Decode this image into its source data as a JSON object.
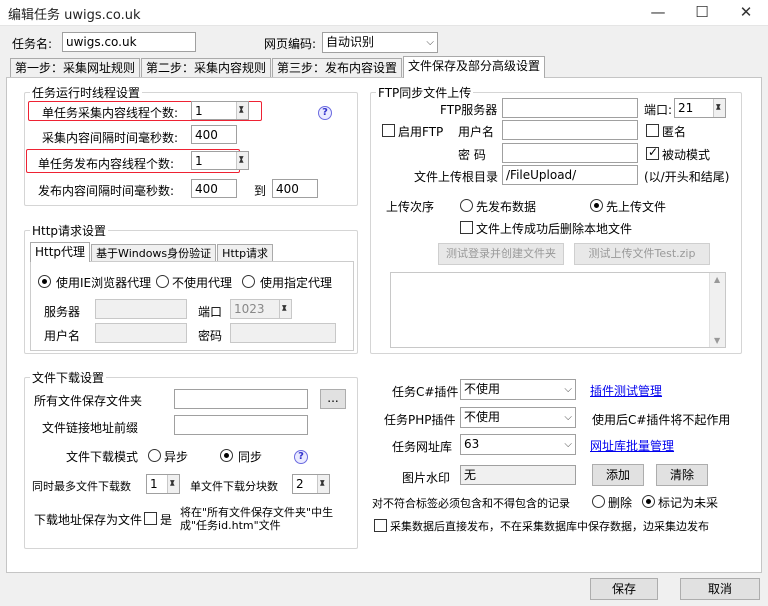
{
  "window": {
    "title": "编辑任务 uwigs.co.uk",
    "minimize": "—",
    "maximize": "☐",
    "close": "✕"
  },
  "task": {
    "name_label": "任务名:",
    "name_value": "uwigs.co.uk",
    "encoding_label": "网页编码:",
    "encoding_value": "自动识别"
  },
  "tabs": [
    "第一步：采集网址规则",
    "第二步：采集内容规则",
    "第三步：发布内容设置",
    "文件保存及部分高级设置"
  ],
  "thread": {
    "title": "任务运行时线程设置",
    "collect_threads_label": "单任务采集内容线程个数:",
    "collect_threads": "1",
    "collect_interval_label": "采集内容间隔时间毫秒数:",
    "collect_interval": "400",
    "publish_threads_label": "单任务发布内容线程个数:",
    "publish_threads": "1",
    "publish_interval_label": "发布内容间隔时间毫秒数:",
    "publish_interval_from": "400",
    "to_label": "到",
    "publish_interval_to": "400",
    "help": "?"
  },
  "http": {
    "title": "Http请求设置",
    "tabs": [
      "Http代理",
      "基于Windows身份验证",
      "Http请求"
    ],
    "radio_ie": "使用IE浏览器代理",
    "radio_none": "不使用代理",
    "radio_custom": "使用指定代理",
    "server_label": "服务器",
    "port_label": "端口",
    "port_value": "1023",
    "user_label": "用户名",
    "password_label": "密码"
  },
  "download": {
    "title": "文件下载设置",
    "save_folder_label": "所有文件保存文件夹",
    "browse": "...",
    "link_prefix_label": "文件链接地址前缀",
    "mode_label": "文件下载模式",
    "async": "异步",
    "sync": "同步",
    "max_files_label": "同时最多文件下载数",
    "max_files": "1",
    "chunks_label": "单文件下载分块数",
    "chunks": "2",
    "save_as_label": "下载地址保存为文件",
    "save_as_yes": "是",
    "save_as_note": "将在\"所有文件保存文件夹\"中生成\"任务id.htm\"文件",
    "help": "?"
  },
  "ftp": {
    "title": "FTP同步文件上传",
    "server_label": "FTP服务器",
    "port_label": "端口:",
    "port_value": "21",
    "enable_label": "启用FTP",
    "user_label": "用户名",
    "anonymous_label": "匿名",
    "password_label": "密 码",
    "passive_label": "被动模式",
    "root_label": "文件上传根目录",
    "root_value": "/FileUpload/",
    "root_hint": "(以/开头和结尾)",
    "order_label": "上传次序",
    "order_publish_first": "先发布数据",
    "order_upload_first": "先上传文件",
    "delete_local_label": "文件上传成功后删除本地文件",
    "test_login_btn": "测试登录并创建文件夹",
    "test_upload_btn": "测试上传文件Test.zip"
  },
  "plugins": {
    "csharp_label": "任务C#插件",
    "csharp_value": "不使用",
    "csharp_link": "插件测试管理",
    "php_label": "任务PHP插件",
    "php_value": "不使用",
    "php_note": "使用后C#插件将不起作用",
    "urldb_label": "任务网址库",
    "urldb_value": "63",
    "urldb_link": "网址库批量管理",
    "watermark_label": "图片水印",
    "watermark_value": "无",
    "add_btn": "添加",
    "clear_btn": "清除",
    "nomatch_label": "对不符合标签必须包含和不得包含的记录",
    "delete_label": "删除",
    "mark_label": "标记为未采",
    "direct_publish_label": "采集数据后直接发布，不在采集数据库中保存数据，边采集边发布"
  },
  "footer": {
    "save": "保存",
    "cancel": "取消"
  }
}
